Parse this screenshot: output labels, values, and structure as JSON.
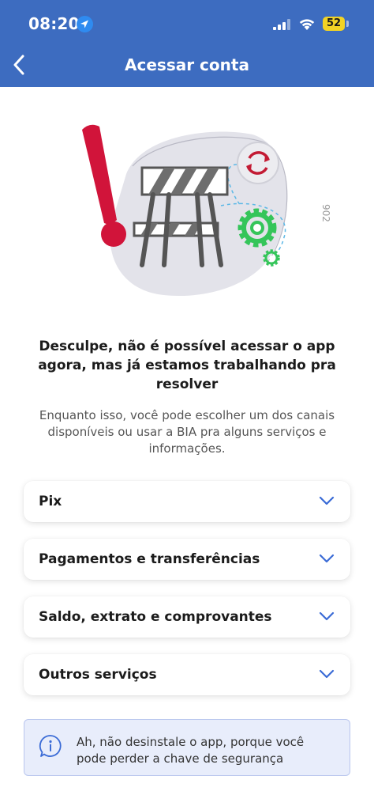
{
  "status_bar": {
    "time": "08:20",
    "battery": "52"
  },
  "header": {
    "title": "Acessar conta"
  },
  "illustration": {
    "side_code": "902",
    "colors": {
      "alert_red": "#d1143a",
      "gear_green": "#35c55a",
      "blob": "#e3e3ea"
    }
  },
  "message": {
    "headline": "Desculpe, não é possível acessar o app agora, mas já estamos trabalhando pra resolver",
    "subtext": "Enquanto isso, você pode escolher um dos canais disponíveis ou usar a BIA pra alguns serviços e informações."
  },
  "channels": [
    {
      "label": "Pix"
    },
    {
      "label": "Pagamentos e transferências"
    },
    {
      "label": "Saldo, extrato e comprovantes"
    },
    {
      "label": "Outros serviços"
    }
  ],
  "info": {
    "text": "Ah, não desinstale o app, porque você pode perder a chave de segurança"
  },
  "colors": {
    "header_bg": "#3d6cc0",
    "chevron": "#3a6bd6",
    "info_bg": "#e8edfb"
  }
}
